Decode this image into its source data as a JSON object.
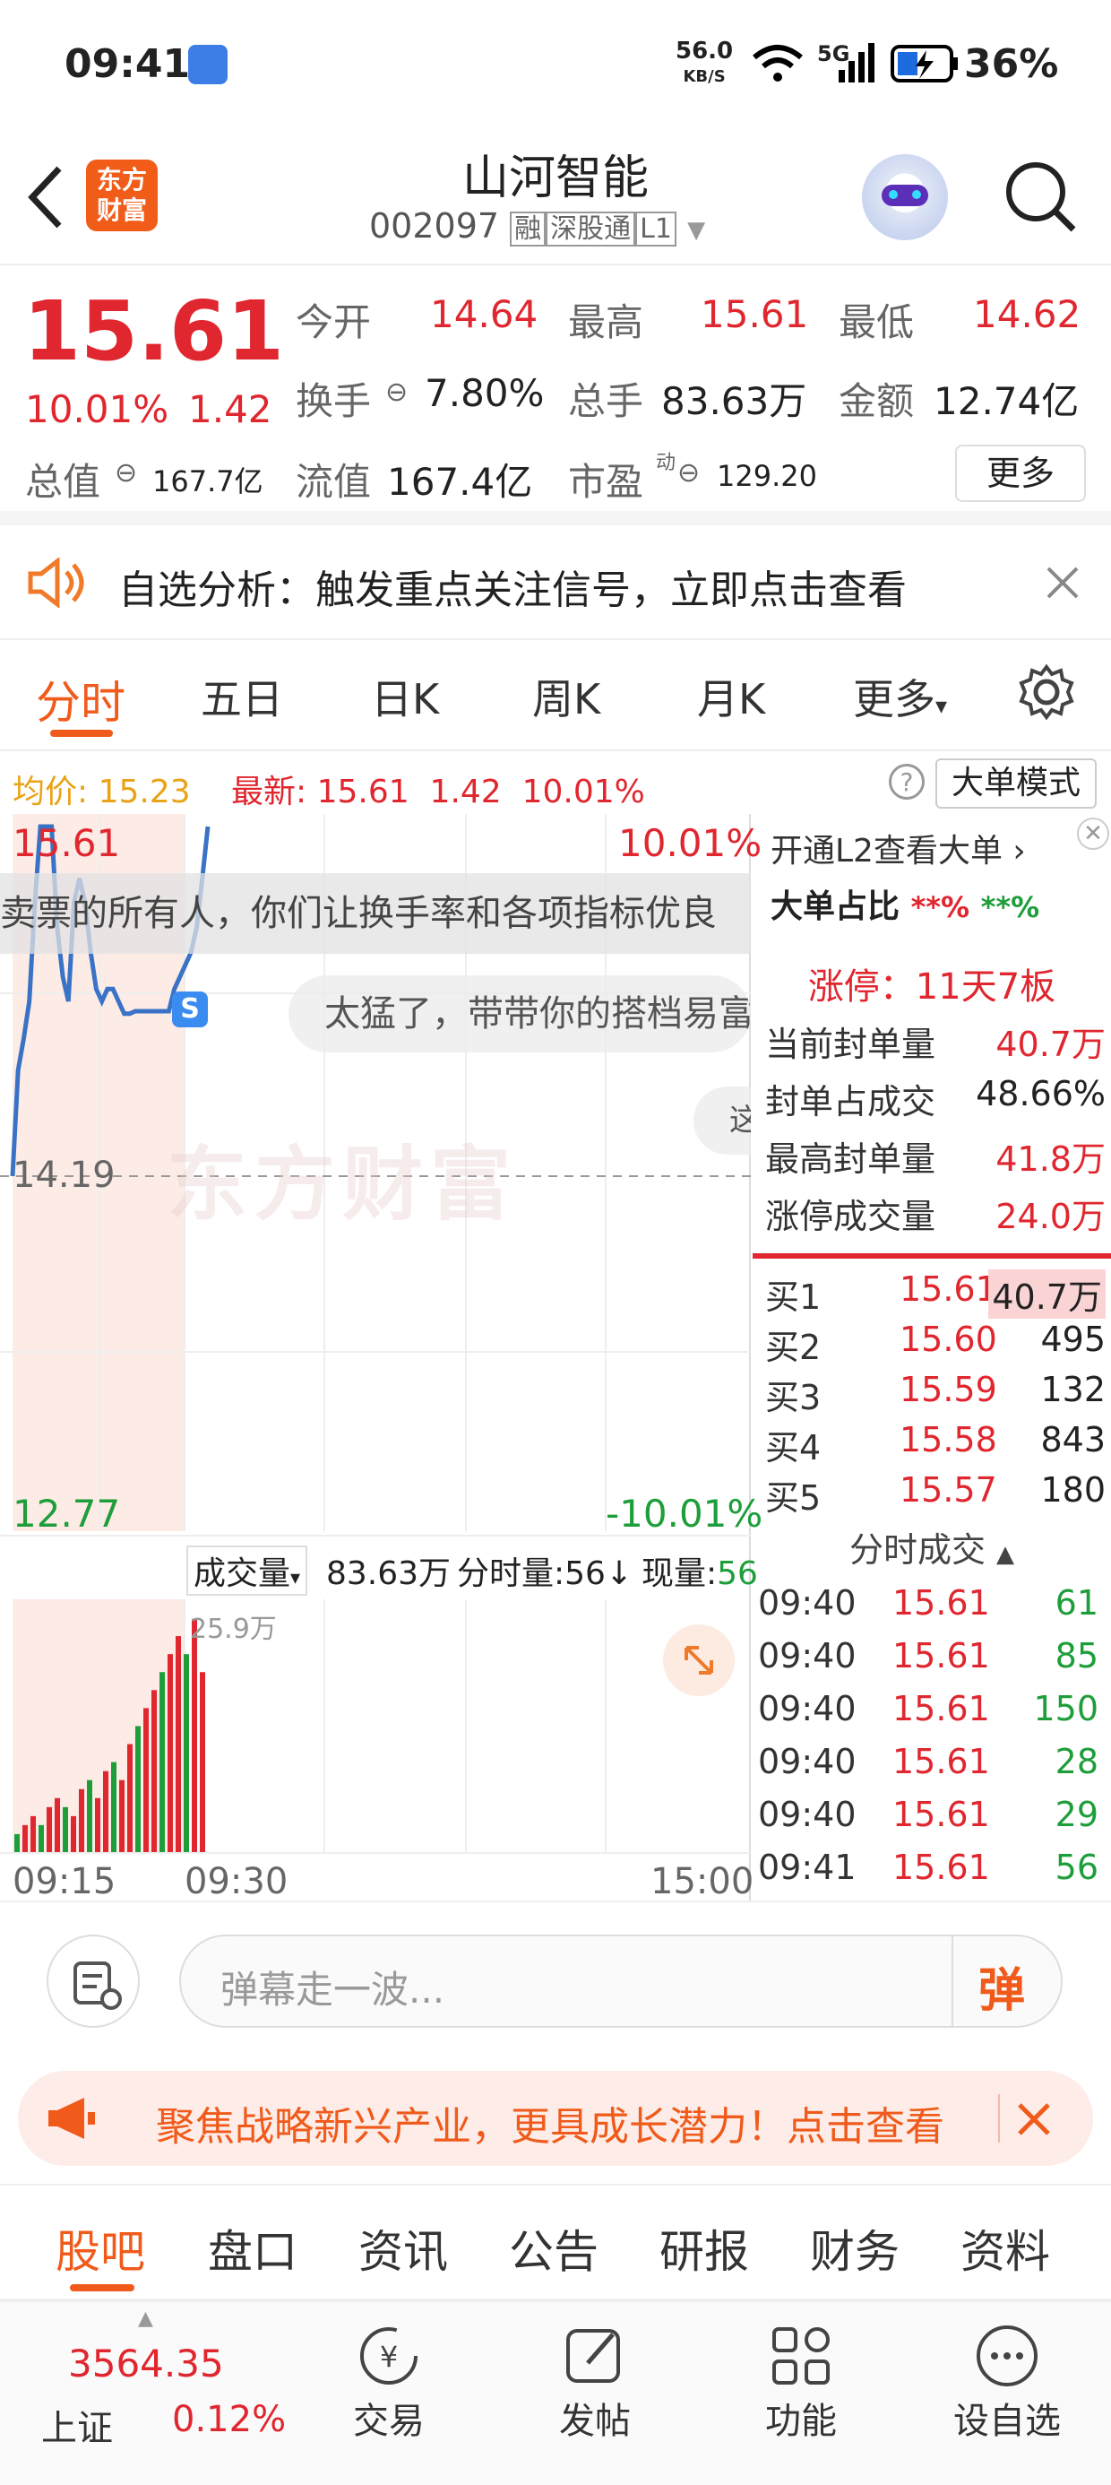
{
  "status": {
    "time": "09:41",
    "speed_top": "56.0",
    "speed_unit": "KB/S",
    "network": "5G",
    "battery": "36%"
  },
  "header": {
    "title": "山河智能",
    "code": "002097",
    "tags": [
      "融",
      "深股通",
      "L1"
    ],
    "logo_line1": "东方",
    "logo_line2": "财富"
  },
  "quote": {
    "price": "15.61",
    "pct": "10.01%",
    "change": "1.42",
    "open_label": "今开",
    "open": "14.64",
    "high_label": "最高",
    "high": "15.61",
    "low_label": "最低",
    "low": "14.62",
    "turnover_label": "换手",
    "turnover": "7.80%",
    "volume_label": "总手",
    "volume": "83.63万",
    "amount_label": "金额",
    "amount": "12.74亿",
    "mcap_label": "总值",
    "mcap": "167.7亿",
    "float_label": "流值",
    "float": "167.4亿",
    "pe_label": "市盈",
    "pe_sup": "动",
    "pe": "129.20",
    "more": "更多"
  },
  "alert": {
    "text": "自选分析：触发重点关注信号，立即点击查看"
  },
  "tabs": [
    {
      "label": "分时",
      "active": true
    },
    {
      "label": "五日"
    },
    {
      "label": "日K"
    },
    {
      "label": "周K"
    },
    {
      "label": "月K"
    },
    {
      "label": "更多"
    }
  ],
  "infobar": {
    "avg_label": "均价:",
    "avg": "15.23",
    "latest_label": "最新:",
    "latest": "15.61",
    "chg": "1.42",
    "pct": "10.01%",
    "mode": "大单模式"
  },
  "chart": {
    "top_price": "15.61",
    "top_pct": "10.01%",
    "mid_price": "14.19",
    "bot_price": "12.77",
    "bot_pct": "-10.01%",
    "danmu1": "卖票的所有人，你们让换手率和各项指标优良",
    "danmu2": "太猛了，带带你的搭档易富",
    "danmu3": "这",
    "watermark": "东方财富",
    "badge": "S",
    "vol_menu": "成交量",
    "vol_total": "83.63万",
    "vol_min_label": "分时量:56↓",
    "vol_now_label": "现量:",
    "vol_now": "56",
    "vol_max": "25.9万",
    "time_start": "09:15",
    "time_mid": "09:30",
    "time_end": "15:00"
  },
  "chart_data": {
    "type": "line",
    "price_points": [
      14.19,
      14.62,
      14.75,
      14.9,
      15.3,
      15.61,
      15.61,
      15.61,
      15.2,
      15.0,
      14.9,
      15.3,
      15.4,
      15.3,
      15.1,
      14.95,
      14.9,
      14.95,
      14.95,
      14.9,
      14.85,
      14.85,
      14.86,
      14.86,
      14.86,
      14.86,
      14.86,
      14.86,
      14.86,
      14.95,
      15.0,
      15.05,
      15.1,
      15.2,
      15.4,
      15.61
    ],
    "ylim": [
      12.77,
      15.61
    ],
    "volume_bars": [
      2,
      3,
      4,
      3,
      5,
      6,
      5,
      4,
      7,
      8,
      6,
      9,
      10,
      8,
      12,
      14,
      16,
      18,
      20,
      22,
      24,
      22,
      25.9,
      20
    ]
  },
  "right": {
    "l2": "开通L2查看大单",
    "big_label": "大单占比",
    "big1": "**%",
    "big2": "**%",
    "limit": "涨停：11天7板",
    "rows": [
      {
        "k": "当前封单量",
        "v": "40.7万"
      },
      {
        "k": "封单占成交",
        "v": "48.66%"
      },
      {
        "k": "最高封单量",
        "v": "41.8万"
      },
      {
        "k": "涨停成交量",
        "v": "24.0万"
      }
    ],
    "book": [
      {
        "k": "买1",
        "p": "15.61",
        "v": "40.7万"
      },
      {
        "k": "买2",
        "p": "15.60",
        "v": "495"
      },
      {
        "k": "买3",
        "p": "15.59",
        "v": "132"
      },
      {
        "k": "买4",
        "p": "15.58",
        "v": "843"
      },
      {
        "k": "买5",
        "p": "15.57",
        "v": "180"
      }
    ],
    "ticks_title": "分时成交",
    "ticks": [
      {
        "t": "09:40",
        "p": "15.61",
        "v": "61"
      },
      {
        "t": "09:40",
        "p": "15.61",
        "v": "85"
      },
      {
        "t": "09:40",
        "p": "15.61",
        "v": "150"
      },
      {
        "t": "09:40",
        "p": "15.61",
        "v": "28"
      },
      {
        "t": "09:40",
        "p": "15.61",
        "v": "29"
      },
      {
        "t": "09:41",
        "p": "15.61",
        "v": "56"
      }
    ]
  },
  "danmu_input": {
    "placeholder": "弹幕走一波...",
    "send": "弹"
  },
  "banner": {
    "text": "聚焦战略新兴产业，更具成长潜力！点击查看"
  },
  "btabs": [
    "股吧",
    "盘口",
    "资讯",
    "公告",
    "研报",
    "财务",
    "资料"
  ],
  "nav": {
    "index_value": "3564.35",
    "index_name": "上证",
    "index_pct": "0.12%",
    "trade": "交易",
    "post": "发帖",
    "func": "功能",
    "watch": "设自选"
  }
}
